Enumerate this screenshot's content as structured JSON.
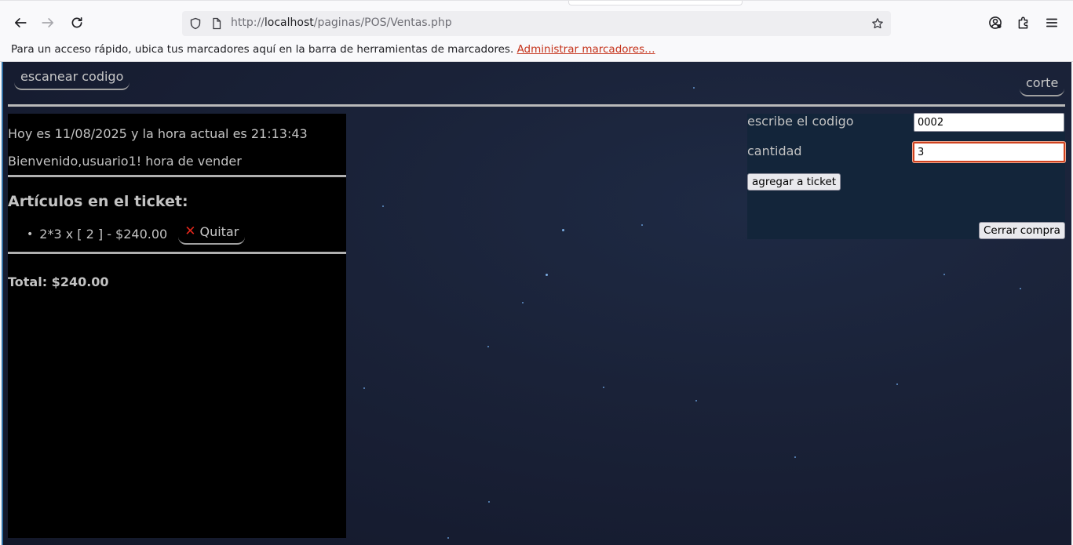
{
  "browser": {
    "url_prefix": "http://",
    "url_host": "localhost",
    "url_path": "/paginas/POS/Ventas.php",
    "bookmarks_text": "Para un acceso rápido, ubica tus marcadores aquí en la barra de herramientas de marcadores.",
    "bookmarks_link": "Administrar marcadores…",
    "icons": [
      "back-arrow-icon",
      "forward-arrow-icon",
      "reload-icon",
      "shield-icon",
      "page-icon",
      "star-icon",
      "account-icon",
      "extensions-icon",
      "menu-icon"
    ]
  },
  "page": {
    "scan_button": "escanear codigo",
    "corte_button": "corte",
    "datetime_text": "Hoy es 11/08/2025 y la hora actual es 21:13:43",
    "welcome_text": "Bienvenido,usuario1! hora de vender",
    "ticket_heading": "Artículos en el ticket:",
    "ticket_items": [
      {
        "text": "2*3 x [ 2 ] - $240.00",
        "remove_label": "Quitar"
      }
    ],
    "total_text": "Total: $240.00",
    "form": {
      "code_label": "escribe el codigo",
      "code_value": "0002",
      "qty_label": "cantidad",
      "qty_value": "3",
      "add_button": "agregar a ticket",
      "close_button": "Cerrar compra"
    }
  },
  "colors": {
    "accent_link": "#c5331b",
    "focus_border": "#d0421f",
    "remove_x": "#e0261b",
    "page_background": "#1a2238"
  }
}
